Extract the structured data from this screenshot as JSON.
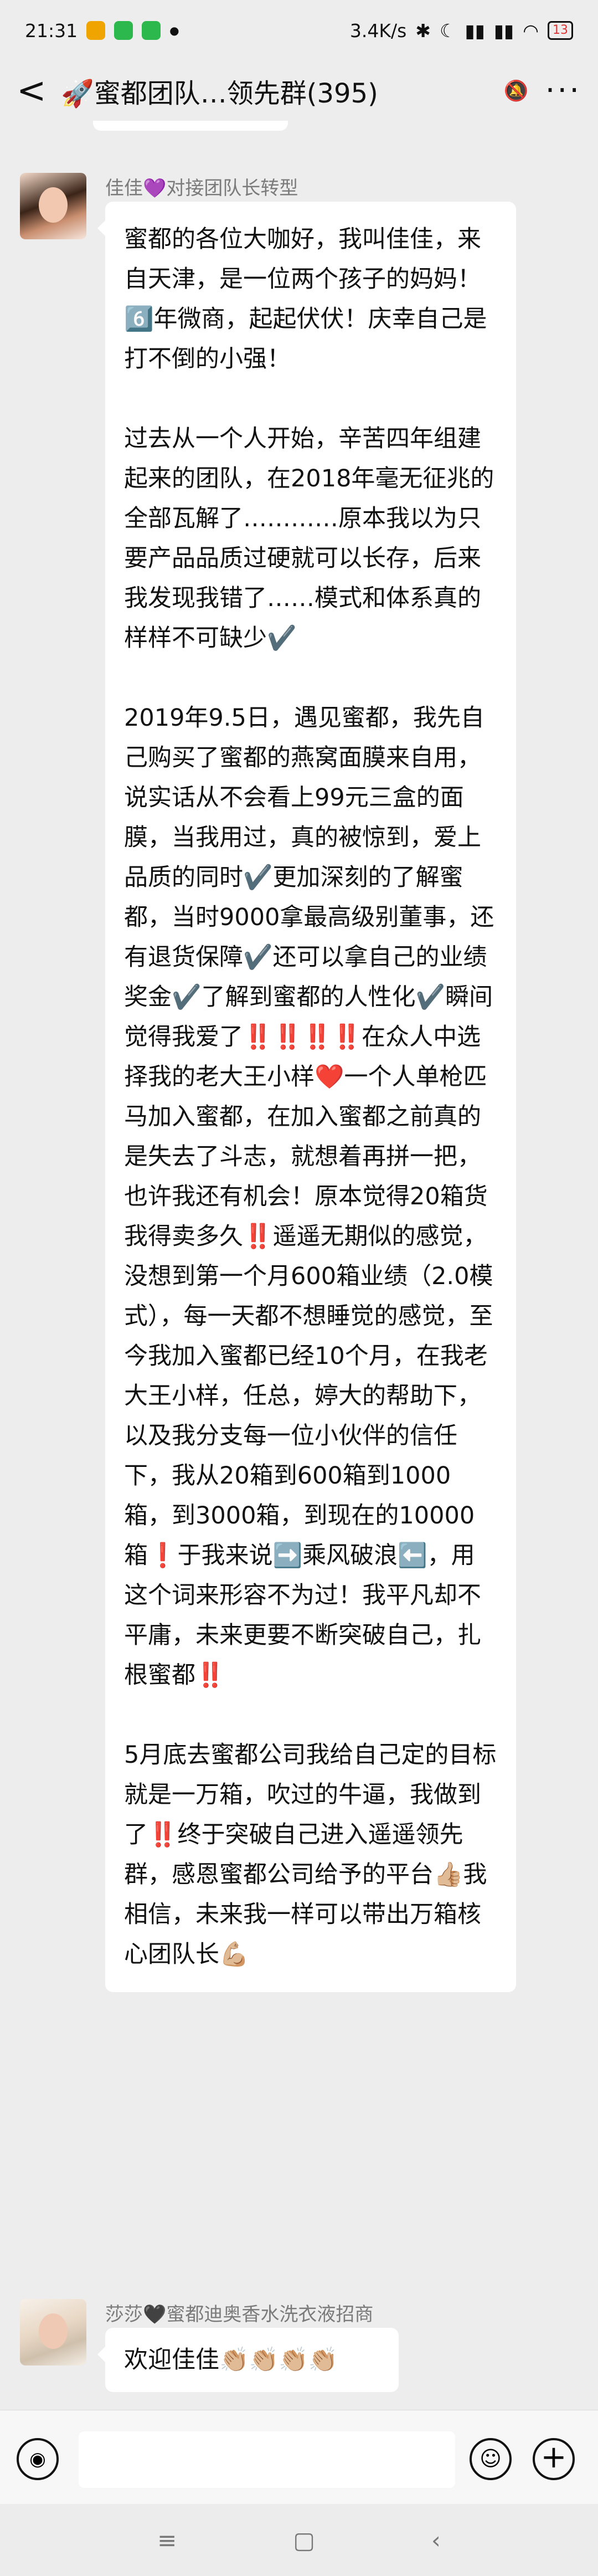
{
  "status_bar": {
    "time": "21:31",
    "network_speed": "3.4K/s",
    "battery": "13"
  },
  "nav": {
    "back_label": "<",
    "title": "🚀蜜都团队…领先群(395)",
    "more_label": "···",
    "mute_icon": "bell-off-icon"
  },
  "messages": [
    {
      "sender": "佳佳💜对接团队长转型",
      "paragraphs": [
        "蜜都的各位大咖好，我叫佳佳，来自天津，是一位两个孩子的妈妈！6️⃣年微商，起起伏伏！庆幸自己是打不倒的小强！",
        "过去从一个人开始，辛苦四年组建起来的团队，在2018年毫无征兆的全部瓦解了…………原本我以为只要产品品质过硬就可以长存，后来我发现我错了……模式和体系真的样样不可缺少✔️",
        "2019年9.5日，遇见蜜都，我先自己购买了蜜都的燕窝面膜来自用，说实话从不会看上99元三盒的面膜，当我用过，真的被惊到，爱上品质的同时✔️更加深刻的了解蜜都，当时9000拿最高级别董事，还有退货保障✔️还可以拿自己的业绩奖金✔️了解到蜜都的人性化✔️瞬间觉得我爱了‼️‼️‼️‼️在众人中选择我的老大王小样❤️一个人单枪匹马加入蜜都，在加入蜜都之前真的是失去了斗志，就想着再拼一把，也许我还有机会！原本觉得20箱货我得卖多久‼️遥遥无期似的感觉，没想到第一个月600箱业绩（2.0模式），每一天都不想睡觉的感觉，至今我加入蜜都已经10个月，在我老大王小样，任总，婷大的帮助下，以及我分支每一位小伙伴的信任下，我从20箱到600箱到1000箱，到3000箱，到现在的10000箱❗于我来说➡️乘风破浪⬅️，用这个词来形容不为过！我平凡却不平庸，未来更要不断突破自己，扎根蜜都‼️",
        "5月底去蜜都公司我给自己定的目标就是一万箱，吹过的牛逼，我做到了‼️终于突破自己进入遥遥领先群，感恩蜜都公司给予的平台👍🏼我相信，未来我一样可以带出万箱核心团队长💪🏼"
      ]
    },
    {
      "sender": "莎莎🖤蜜都迪奥香水洗衣液招商",
      "text": "欢迎佳佳👏🏼👏🏼👏🏼👏🏼"
    }
  ],
  "input_bar": {
    "placeholder": "",
    "voice_icon": "voice-icon",
    "emoji_icon": "emoji-icon",
    "plus_icon": "plus-icon"
  },
  "system_nav": {
    "menu_icon": "menu-icon",
    "home_icon": "home-icon",
    "back_icon": "back-icon"
  }
}
